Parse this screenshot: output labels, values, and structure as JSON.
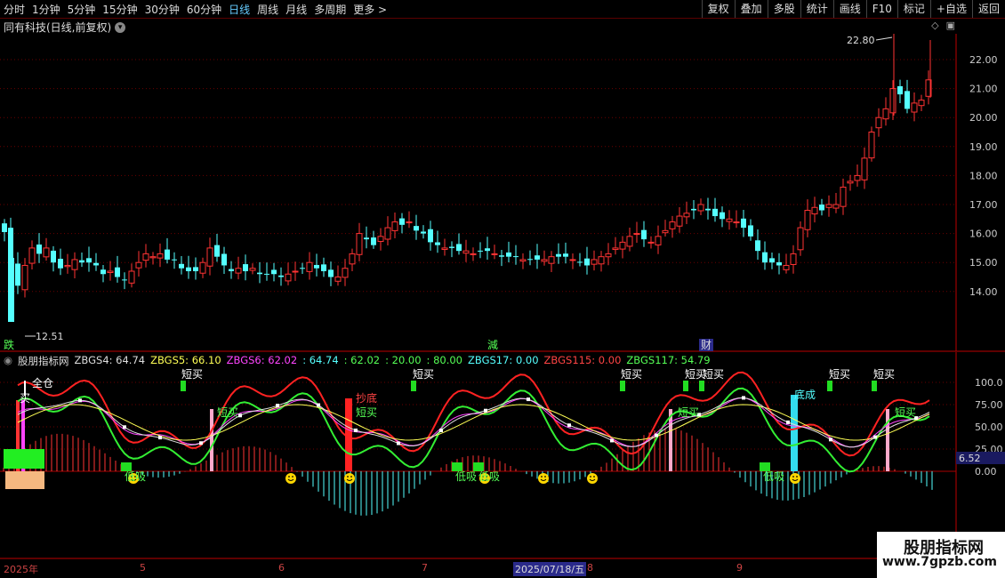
{
  "toolbar": {
    "periods": [
      "分时",
      "1分钟",
      "5分钟",
      "15分钟",
      "30分钟",
      "60分钟",
      "日线",
      "周线",
      "月线",
      "多周期",
      "更多 >"
    ],
    "active_period": "日线",
    "right_buttons": [
      "复权",
      "叠加",
      "多股",
      "统计",
      "画线",
      "F10",
      "标记",
      "+自选",
      "返回"
    ]
  },
  "title": "同有科技(日线,前复权)",
  "price_axis": [
    "22.00",
    "21.00",
    "20.00",
    "19.00",
    "18.00",
    "17.00",
    "16.00",
    "15.00",
    "14.00"
  ],
  "high_label": "22.80",
  "low_label": "12.51",
  "bottom_markers": {
    "left": "跌",
    "mid": "減",
    "right": "财"
  },
  "indicator": {
    "name": "股朋指标网",
    "values": [
      {
        "text": "ZBGS4: 64.74",
        "color": "#dddddd"
      },
      {
        "text": "ZBGS5: 66.10",
        "color": "#ffff55"
      },
      {
        "text": "ZBGS6: 62.02",
        "color": "#ff44ff"
      },
      {
        "text": ": 64.74",
        "color": "#55ffff"
      },
      {
        "text": ": 62.02",
        "color": "#55ff55"
      },
      {
        "text": ": 20.00",
        "color": "#55ff55"
      },
      {
        "text": ": 80.00",
        "color": "#55ff55"
      },
      {
        "text": "ZBGS17: 0.00",
        "color": "#55ffff"
      },
      {
        "text": "ZBGS115: 0.00",
        "color": "#ff4444"
      },
      {
        "text": "ZBGS117: 54.79",
        "color": "#55ff55"
      }
    ],
    "axis": [
      "100.0",
      "75.00",
      "50.00",
      "25.00",
      "0.00"
    ],
    "current": "6.52",
    "labels": {
      "full": "全仓",
      "buy": "买",
      "short_buy": "短买",
      "bottom": "抄底",
      "absorb": "低吸",
      "bottom_done": "底成"
    }
  },
  "dates": {
    "year": "2025年",
    "m5": "5",
    "m6": "6",
    "m7": "7",
    "m8": "8",
    "m9": "9",
    "current": "2025/07/18/五"
  },
  "watermark": {
    "line1": "股朋指标网",
    "line2": "www.7gpzb.com"
  }
}
